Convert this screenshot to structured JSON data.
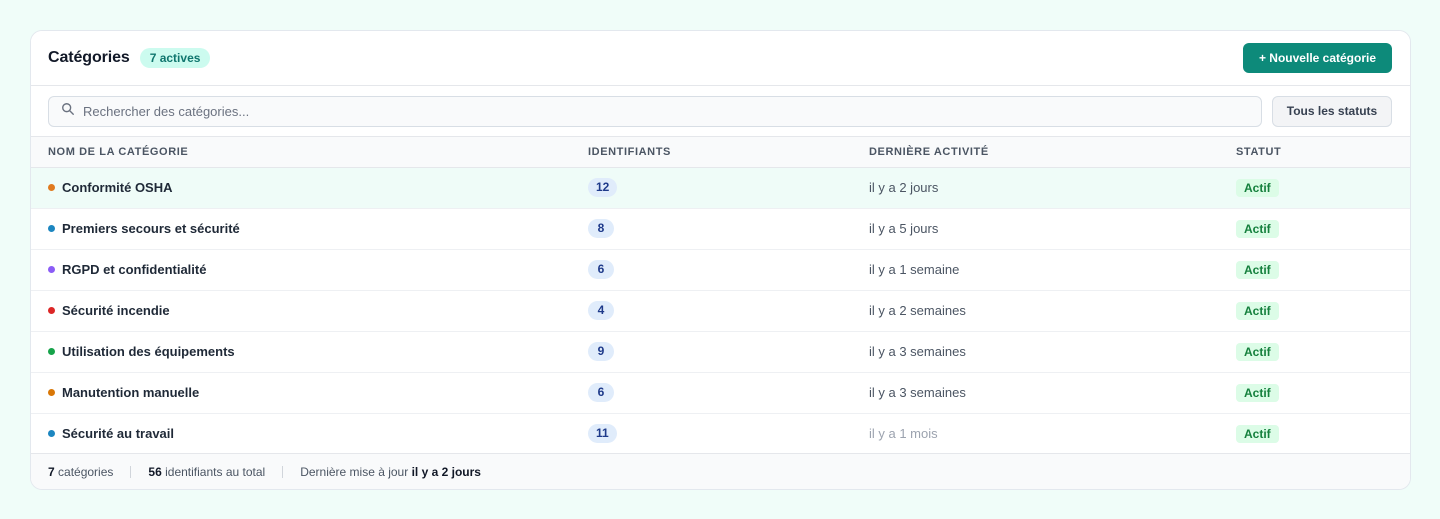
{
  "header": {
    "title": "Catégories",
    "active_badge": "7 actives",
    "new_button": "+ Nouvelle catégorie"
  },
  "toolbar": {
    "search_placeholder": "Rechercher des catégories...",
    "status_filter": "Tous les statuts"
  },
  "table": {
    "columns": [
      "Nom de la catégorie",
      "Identifiants",
      "Dernière activité",
      "Statut"
    ],
    "rows": [
      {
        "name": "Conformité OSHA",
        "dot_color": "#e07a1f",
        "ids": "12",
        "activity": "il y a 2 jours",
        "status": "Actif"
      },
      {
        "name": "Premiers secours et sécurité",
        "dot_color": "#1c86c0",
        "ids": "8",
        "activity": "il y a 5 jours",
        "status": "Actif"
      },
      {
        "name": "RGPD et confidentialité",
        "dot_color": "#8b5cf6",
        "ids": "6",
        "activity": "il y a 1 semaine",
        "status": "Actif"
      },
      {
        "name": "Sécurité incendie",
        "dot_color": "#dc2626",
        "ids": "4",
        "activity": "il y a 2 semaines",
        "status": "Actif"
      },
      {
        "name": "Utilisation des équipements",
        "dot_color": "#16a34a",
        "ids": "9",
        "activity": "il y a 3 semaines",
        "status": "Actif"
      },
      {
        "name": "Manutention manuelle",
        "dot_color": "#d97706",
        "ids": "6",
        "activity": "il y a 3 semaines",
        "status": "Actif"
      },
      {
        "name": "Sécurité au travail",
        "dot_color": "#1c86c0",
        "ids": "11",
        "activity": "il y a 1 mois",
        "status": "Actif"
      }
    ]
  },
  "footer": {
    "categories_count": "7",
    "categories_label": "catégories",
    "ids_total": "56",
    "ids_label": "identifiants au total",
    "last_update_label": "Dernière mise à jour",
    "last_update_value": "il y a 2 jours"
  }
}
